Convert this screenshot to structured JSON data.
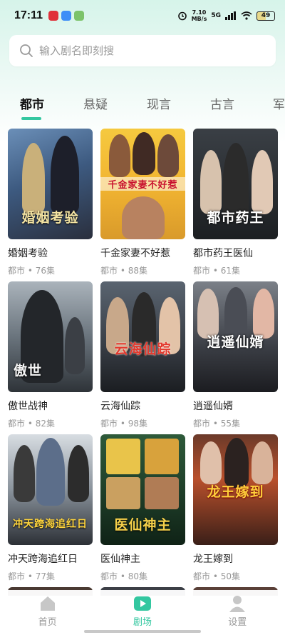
{
  "status_bar": {
    "time": "17:11",
    "speed_value": "7.10",
    "speed_unit": "MB/s",
    "network": "5G",
    "battery": "49"
  },
  "search": {
    "placeholder": "输入剧名即刻搜"
  },
  "tabs": [
    {
      "label": "都市",
      "active": true
    },
    {
      "label": "悬疑"
    },
    {
      "label": "现言"
    },
    {
      "label": "古言"
    },
    {
      "label": "军"
    }
  ],
  "dramas": [
    {
      "title": "婚姻考验",
      "meta": "都市 • 76集",
      "poster_text": "婚姻考验"
    },
    {
      "title": "千金家妻不好惹",
      "meta": "都市 • 88集",
      "poster_text": "千金家妻不好惹"
    },
    {
      "title": "都市药王医仙",
      "meta": "都市 • 61集",
      "poster_text": "都市药王"
    },
    {
      "title": "傲世战神",
      "meta": "都市 • 82集",
      "poster_text": "傲世"
    },
    {
      "title": "云海仙踪",
      "meta": "都市 • 98集",
      "poster_text": "云海仙踪"
    },
    {
      "title": "逍遥仙婿",
      "meta": "都市 • 55集",
      "poster_text": "逍遥仙婿"
    },
    {
      "title": "冲天跨海追红日",
      "meta": "都市 • 77集",
      "poster_text": "冲天跨海追红日"
    },
    {
      "title": "医仙神主",
      "meta": "都市 • 80集",
      "poster_text": "医仙神主"
    },
    {
      "title": "龙王嫁到",
      "meta": "都市 • 50集",
      "poster_text": "龙王嫁到"
    }
  ],
  "bottom_nav": [
    {
      "label": "首页",
      "icon": "home-icon"
    },
    {
      "label": "剧场",
      "icon": "theater-play-icon",
      "active": true
    },
    {
      "label": "设置",
      "icon": "profile-icon"
    }
  ],
  "colors": {
    "accent": "#33c7a0",
    "text_muted": "#999999"
  }
}
